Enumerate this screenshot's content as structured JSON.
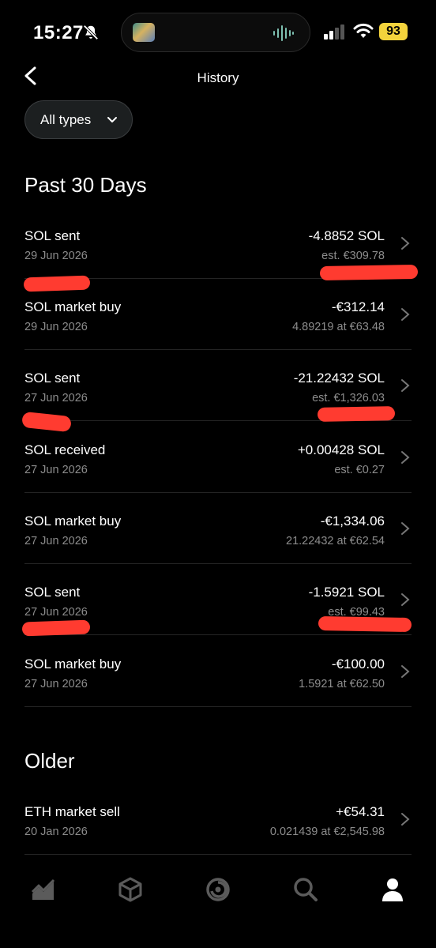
{
  "status_bar": {
    "time": "15:27",
    "battery": "93"
  },
  "header": {
    "title": "History",
    "back_icon": "chevron-left-icon"
  },
  "filter": {
    "label": "All types"
  },
  "sections": {
    "recent": {
      "title": "Past 30 Days"
    },
    "older": {
      "title": "Older"
    }
  },
  "transactions": [
    {
      "name": "SOL sent",
      "date": "29 Jun 2026",
      "amount": "-4.8852 SOL",
      "sub": "est. €309.78"
    },
    {
      "name": "SOL market buy",
      "date": "29 Jun 2026",
      "amount": "-€312.14",
      "sub": "4.89219 at €63.48"
    },
    {
      "name": "SOL sent",
      "date": "27 Jun 2026",
      "amount": "-21.22432 SOL",
      "sub": "est. €1,326.03"
    },
    {
      "name": "SOL received",
      "date": "27 Jun 2026",
      "amount": "+0.00428 SOL",
      "sub": "est. €0.27"
    },
    {
      "name": "SOL market buy",
      "date": "27 Jun 2026",
      "amount": "-€1,334.06",
      "sub": "21.22432 at €62.54"
    },
    {
      "name": "SOL sent",
      "date": "27 Jun 2026",
      "amount": "-1.5921 SOL",
      "sub": "est. €99.43"
    },
    {
      "name": "SOL market buy",
      "date": "27 Jun 2026",
      "amount": "-€100.00",
      "sub": "1.5921 at €62.50"
    },
    {
      "name": "ETH market sell",
      "date": "20 Jan 2026",
      "amount": "+€54.31",
      "sub": "0.021439 at €2,545.98"
    }
  ],
  "tabbar": {
    "items": [
      "chart-icon",
      "cube-icon",
      "swirl-icon",
      "search-icon",
      "profile-icon"
    ],
    "active": "profile-icon"
  },
  "colors": {
    "background": "#000000",
    "redaction": "#ff3b30",
    "muted_text": "#8c8c8c",
    "battery": "#f3d33c"
  }
}
